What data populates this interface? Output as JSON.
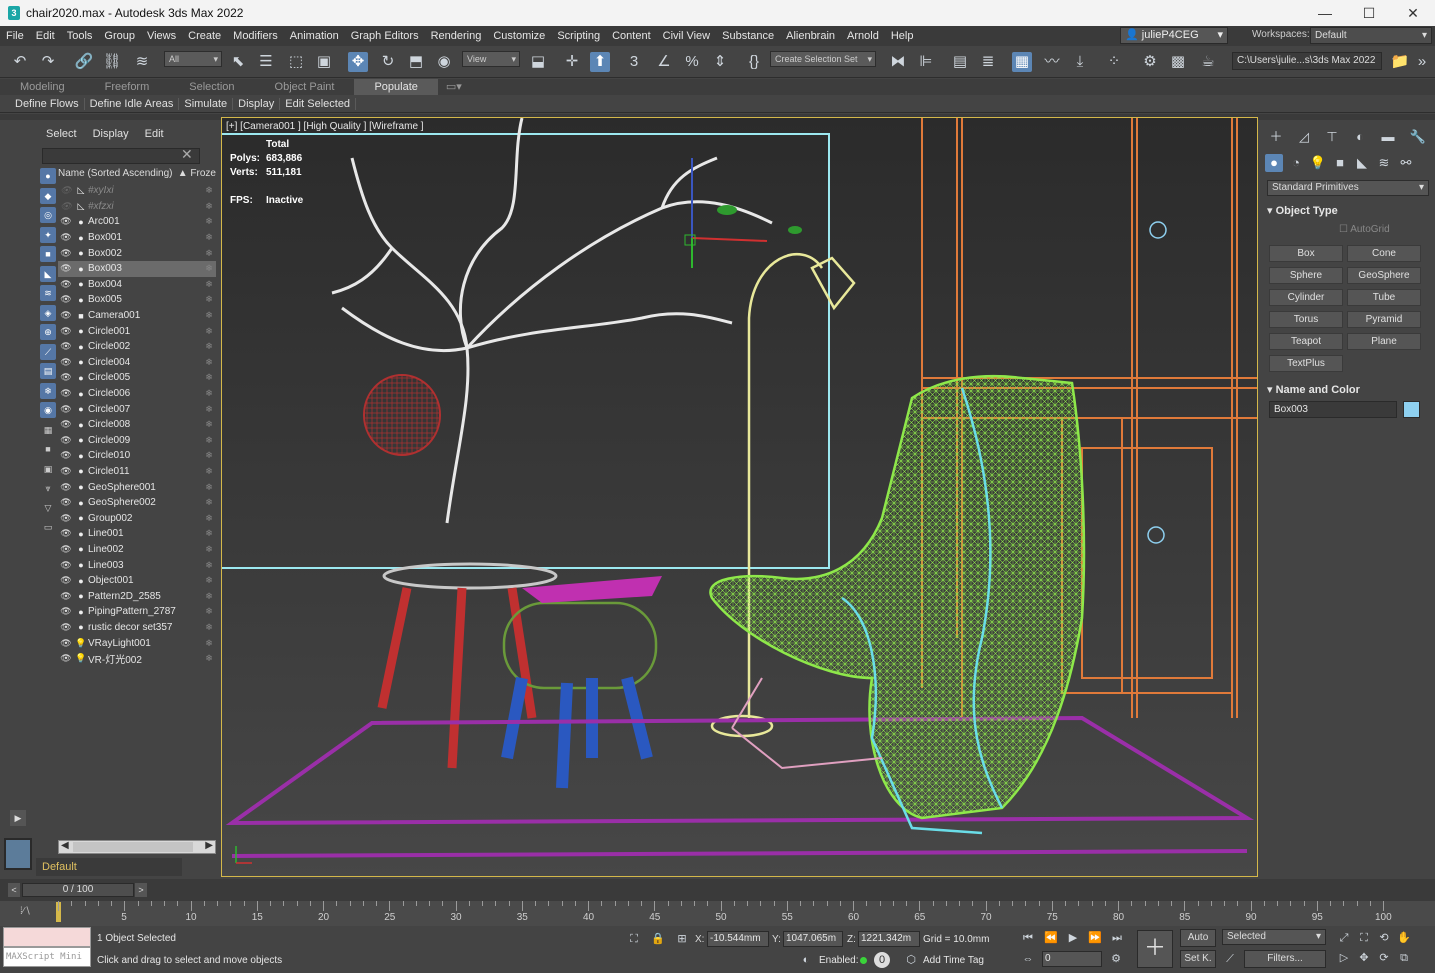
{
  "window": {
    "title": "chair2020.max - Autodesk 3ds Max 2022",
    "icon_text": "3",
    "controls": [
      "—",
      "☐",
      "✕"
    ]
  },
  "menu": {
    "items": [
      "File",
      "Edit",
      "Tools",
      "Group",
      "Views",
      "Create",
      "Modifiers",
      "Animation",
      "Graph Editors",
      "Rendering",
      "Customize",
      "Scripting",
      "Content",
      "Civil View",
      "Substance",
      "Alienbrain",
      "Arnold",
      "Help"
    ],
    "user": "julieP4CEG",
    "workspaces_label": "Workspaces:",
    "workspace": "Default"
  },
  "toolbar": {
    "selection_filter": "All",
    "ref_coord": "View",
    "named_selection": "Create Selection Set",
    "project_path": "C:\\Users\\julie...s\\3ds Max 2022"
  },
  "ribbon": {
    "tabs": [
      "Modeling",
      "Freeform",
      "Selection",
      "Object Paint",
      "Populate"
    ],
    "active_tab": "Populate",
    "sub_buttons": [
      "Define Flows",
      "Define Idle Areas",
      "Simulate",
      "Display",
      "Edit Selected"
    ]
  },
  "explorer": {
    "tabs": [
      "Select",
      "Display",
      "Edit"
    ],
    "column_name": "Name (Sorted Ascending)",
    "column_frozen": "▲ Froze",
    "rows": [
      {
        "name": "#xyIxi",
        "type": "dim"
      },
      {
        "name": "#xfzxi",
        "type": "dim"
      },
      {
        "name": "Arc001",
        "type": "obj"
      },
      {
        "name": "Box001",
        "type": "obj"
      },
      {
        "name": "Box002",
        "type": "obj"
      },
      {
        "name": "Box003",
        "type": "sel"
      },
      {
        "name": "Box004",
        "type": "obj"
      },
      {
        "name": "Box005",
        "type": "obj"
      },
      {
        "name": "Camera001",
        "type": "cam"
      },
      {
        "name": "Circle001",
        "type": "obj"
      },
      {
        "name": "Circle002",
        "type": "obj"
      },
      {
        "name": "Circle004",
        "type": "obj"
      },
      {
        "name": "Circle005",
        "type": "obj"
      },
      {
        "name": "Circle006",
        "type": "obj"
      },
      {
        "name": "Circle007",
        "type": "obj"
      },
      {
        "name": "Circle008",
        "type": "obj"
      },
      {
        "name": "Circle009",
        "type": "obj"
      },
      {
        "name": "Circle010",
        "type": "obj"
      },
      {
        "name": "Circle011",
        "type": "obj"
      },
      {
        "name": "GeoSphere001",
        "type": "obj"
      },
      {
        "name": "GeoSphere002",
        "type": "obj"
      },
      {
        "name": "Group002",
        "type": "obj"
      },
      {
        "name": "Line001",
        "type": "obj"
      },
      {
        "name": "Line002",
        "type": "obj"
      },
      {
        "name": "Line003",
        "type": "obj"
      },
      {
        "name": "Object001",
        "type": "obj"
      },
      {
        "name": "Pattern2D_2585",
        "type": "obj"
      },
      {
        "name": "PipingPattern_2787",
        "type": "obj"
      },
      {
        "name": "rustic decor set357",
        "type": "obj"
      },
      {
        "name": "VRayLight001",
        "type": "light"
      },
      {
        "name": "VR-灯光002",
        "type": "light"
      }
    ],
    "layer": "Default"
  },
  "viewport": {
    "label": "[+] [Camera001 ] [High Quality ] [Wireframe ]",
    "stats_total": "Total",
    "polys_label": "Polys:",
    "polys": "683,886",
    "verts_label": "Verts:",
    "verts": "511,181",
    "fps_label": "FPS:",
    "fps": "Inactive"
  },
  "command_panel": {
    "category": "Standard Primitives",
    "object_type_title": "Object Type",
    "autogrid": "AutoGrid",
    "primitives": [
      "Box",
      "Cone",
      "Sphere",
      "GeoSphere",
      "Cylinder",
      "Tube",
      "Torus",
      "Pyramid",
      "Teapot",
      "Plane",
      "TextPlus"
    ],
    "name_color_title": "Name and Color",
    "object_name": "Box003",
    "object_color": "#8ed0f0"
  },
  "timeline": {
    "frame": "0 / 100",
    "ticks": [
      0,
      5,
      10,
      15,
      20,
      25,
      30,
      35,
      40,
      45,
      50,
      55,
      60,
      65,
      70,
      75,
      80,
      85,
      90,
      95,
      100
    ]
  },
  "status": {
    "maxscript": "MAXScript Mini",
    "selected": "1 Object Selected",
    "prompt": "Click and drag to select and move objects",
    "x_label": "X:",
    "x": "-10.544mm",
    "y_label": "Y:",
    "y": "1047.065m",
    "z_label": "Z:",
    "z": "1221.342m",
    "grid": "Grid = 10.0mm",
    "enabled": "Enabled:",
    "add_time_tag": "Add Time Tag",
    "auto": "Auto",
    "set_key": "Set K.",
    "key_filter": "Selected",
    "filters": "Filters...",
    "frame_field": "0"
  },
  "colors": {
    "accent": "#5c86b5",
    "viewport_border": "#d4b84a",
    "chair": "#8ee84a",
    "frame": "#e07a3a",
    "rug": "#9a2fa8"
  }
}
